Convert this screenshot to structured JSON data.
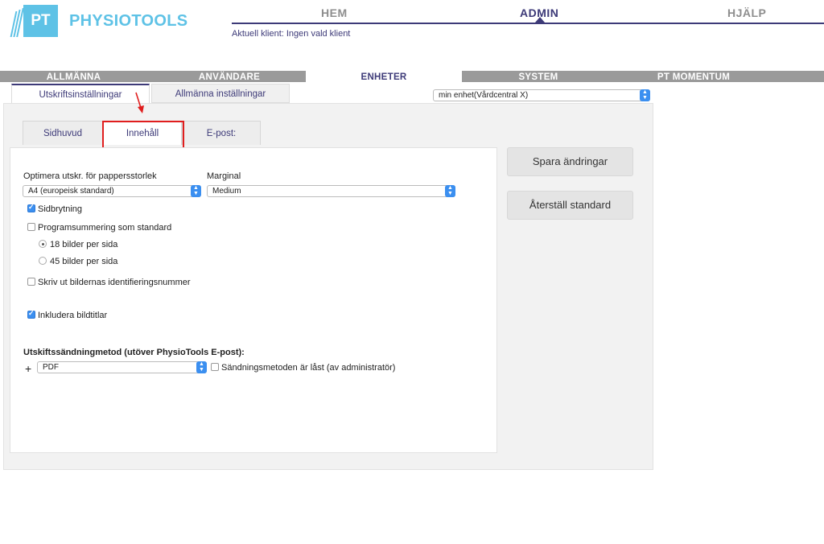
{
  "brand": {
    "logo_text": "PT",
    "name": "PHYSIOTOOLS"
  },
  "topnav": [
    {
      "label": "HEM"
    },
    {
      "label": "ADMIN"
    },
    {
      "label": "HJÄLP"
    }
  ],
  "client_text": "Aktuell klient: Ingen vald klient",
  "main_tabs": [
    {
      "label": "ALLMÄNNA"
    },
    {
      "label": "ANVÄNDARE"
    },
    {
      "label": "ENHETER"
    },
    {
      "label": "SYSTEM"
    },
    {
      "label": "PT MOMENTUM"
    }
  ],
  "sub_tabs": [
    {
      "label": "Utskriftsinställningar"
    },
    {
      "label": "Allmänna inställningar"
    }
  ],
  "unit_select": {
    "value": "min enhet(Vårdcentral X)"
  },
  "inner_tabs": [
    {
      "label": "Sidhuvud"
    },
    {
      "label": "Innehåll"
    },
    {
      "label": "E-post:"
    }
  ],
  "form": {
    "paper_label": "Optimera utskr. för pappersstorlek",
    "paper_value": "A4 (europeisk standard)",
    "margin_label": "Marginal",
    "margin_value": "Medium",
    "page_break": "Sidbrytning",
    "program_summary": "Programsummering som standard",
    "radio_18": "18 bilder per sida",
    "radio_45": "45 bilder per sida",
    "print_ids": "Skriv ut bildernas identifieringsnummer",
    "include_titles": "Inkludera bildtitlar",
    "send_method_label": "Utskiftssändningmetod (utöver PhysioTools E-post):",
    "plus": "+",
    "send_method_value": "PDF",
    "locked_label": "Sändningsmetoden är låst (av administratör)"
  },
  "buttons": {
    "save": "Spara ändringar",
    "reset": "Återställ standard"
  },
  "colors": {
    "accent": "#3d3a78",
    "brand": "#5ec2e6",
    "highlight": "#e01e1e",
    "select_blue": "#3b8ff0"
  }
}
